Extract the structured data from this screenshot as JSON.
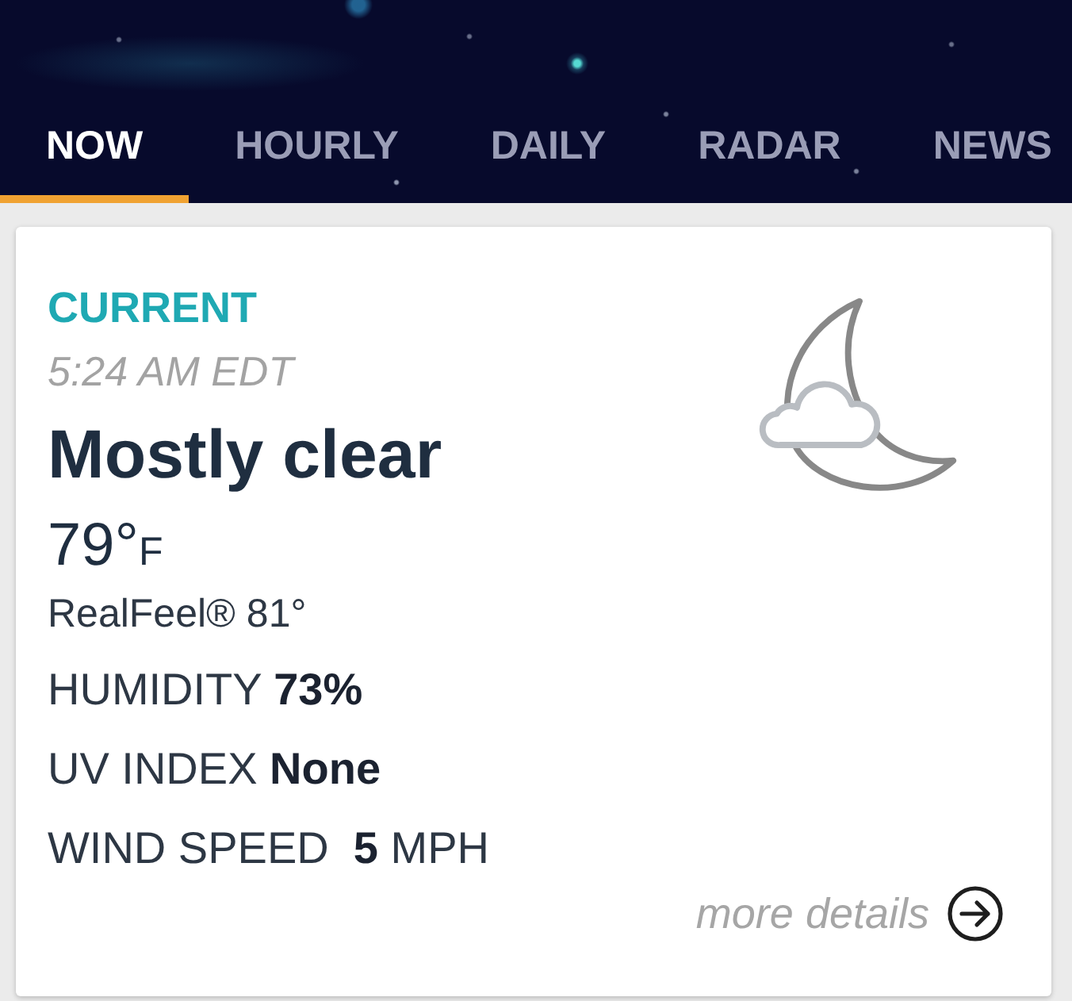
{
  "tabs": [
    {
      "label": "NOW",
      "selected": true
    },
    {
      "label": "HOURLY",
      "selected": false
    },
    {
      "label": "DAILY",
      "selected": false
    },
    {
      "label": "RADAR",
      "selected": false
    },
    {
      "label": "NEWS",
      "selected": false
    }
  ],
  "current": {
    "heading": "CURRENT",
    "time": "5:24 AM EDT",
    "condition": "Mostly clear",
    "temperature": "79°",
    "unit": "F",
    "realfeel": "RealFeel® 81°",
    "details": [
      "HUMIDITY **73%**",
      "UV INDEX **None**",
      "WIND SPEED  **5** MPH"
    ],
    "more_link": "more details"
  }
}
